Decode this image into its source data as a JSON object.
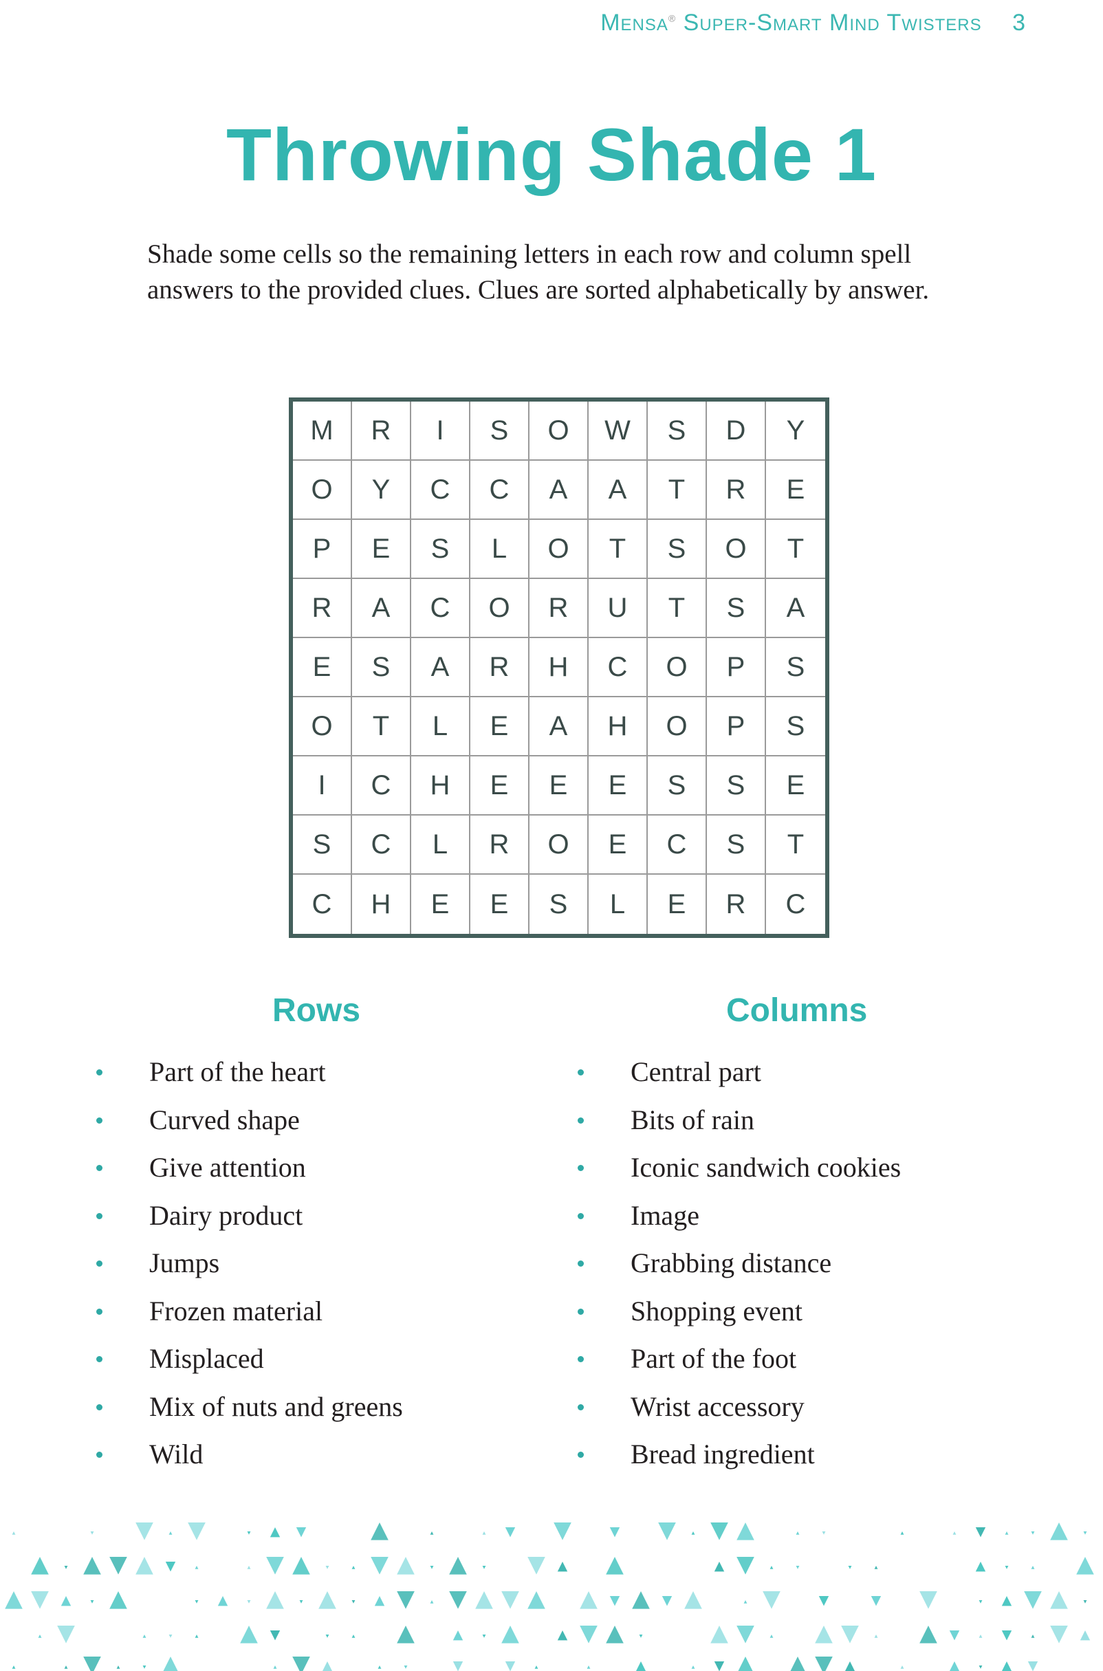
{
  "header": {
    "running_title": "Mensa",
    "registered_mark": "®",
    "running_title_rest": "Super-Smart Mind Twisters",
    "page_number": "3"
  },
  "puzzle": {
    "title": "Throwing Shade 1",
    "instructions": "Shade some cells so the remaining letters in each row and column spell answers to the provided clues. Clues are sorted alphabetically by answer.",
    "grid": [
      [
        "M",
        "R",
        "I",
        "S",
        "O",
        "W",
        "S",
        "D",
        "Y"
      ],
      [
        "O",
        "Y",
        "C",
        "C",
        "A",
        "A",
        "T",
        "R",
        "E"
      ],
      [
        "P",
        "E",
        "S",
        "L",
        "O",
        "T",
        "S",
        "O",
        "T"
      ],
      [
        "R",
        "A",
        "C",
        "O",
        "R",
        "U",
        "T",
        "S",
        "A"
      ],
      [
        "E",
        "S",
        "A",
        "R",
        "H",
        "C",
        "O",
        "P",
        "S"
      ],
      [
        "O",
        "T",
        "L",
        "E",
        "A",
        "H",
        "O",
        "P",
        "S"
      ],
      [
        "I",
        "C",
        "H",
        "E",
        "E",
        "E",
        "S",
        "S",
        "E"
      ],
      [
        "S",
        "C",
        "L",
        "R",
        "O",
        "E",
        "C",
        "S",
        "T"
      ],
      [
        "C",
        "H",
        "E",
        "E",
        "S",
        "L",
        "E",
        "R",
        "C"
      ]
    ]
  },
  "clues": {
    "rows_heading": "Rows",
    "columns_heading": "Columns",
    "rows": [
      "Part of the heart",
      "Curved shape",
      "Give attention",
      "Dairy product",
      "Jumps",
      "Frozen material",
      "Misplaced",
      "Mix of nuts and greens",
      "Wild"
    ],
    "columns": [
      "Central part",
      "Bits of rain",
      "Iconic sandwich cookies",
      "Image",
      "Grabbing distance",
      "Shopping event",
      "Part of the foot",
      "Wrist accessory",
      "Bread ingredient"
    ]
  },
  "theme": {
    "accent_color": "#33b5b0",
    "grid_border_color": "#44605c",
    "decoration": "teal-triangle-pattern"
  }
}
